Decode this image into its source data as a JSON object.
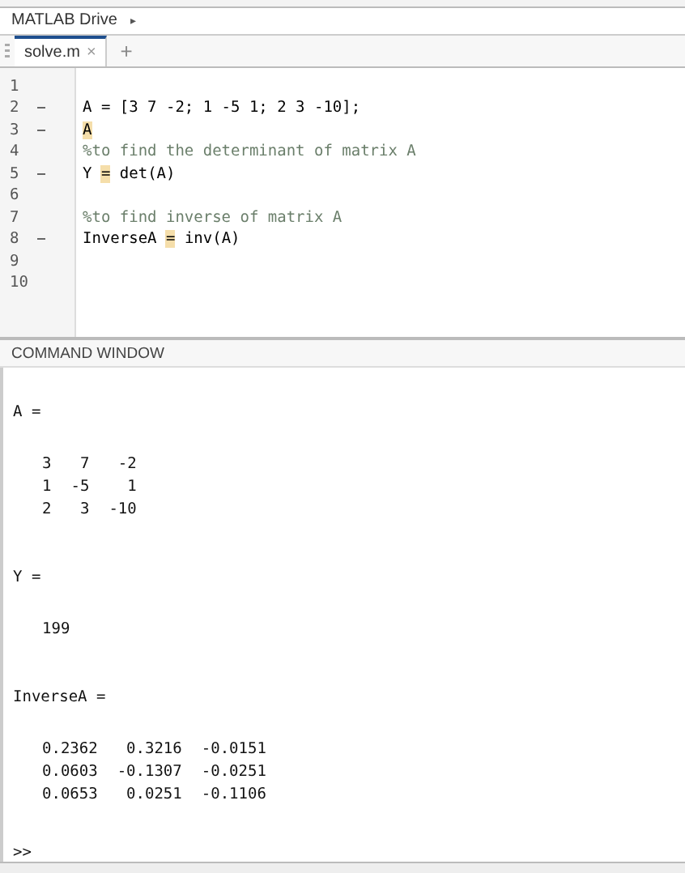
{
  "breadcrumb": {
    "label": "MATLAB Drive",
    "separator": "▸"
  },
  "tabs": [
    {
      "label": "solve.m",
      "selected": true,
      "close": "×"
    }
  ],
  "new_tab": "+",
  "editor": {
    "lines": [
      {
        "number": "1",
        "executable": false
      },
      {
        "number": "2",
        "executable": true,
        "kind": "code",
        "segments": [
          {
            "text": "A = [3 7 -2; 1 -5 1; 2 3 -10];",
            "highlight": false
          }
        ]
      },
      {
        "number": "3",
        "executable": true,
        "kind": "code",
        "segments": [
          {
            "text": "A",
            "highlight": true
          }
        ]
      },
      {
        "number": "4",
        "executable": false,
        "kind": "comment",
        "segments": [
          {
            "text": "%to find the determinant of matrix A",
            "highlight": false
          }
        ]
      },
      {
        "number": "5",
        "executable": true,
        "kind": "code",
        "segments": [
          {
            "text": "Y ",
            "highlight": false
          },
          {
            "text": "=",
            "highlight": true
          },
          {
            "text": " det(A)",
            "highlight": false
          }
        ]
      },
      {
        "number": "6",
        "executable": false
      },
      {
        "number": "7",
        "executable": false,
        "kind": "comment",
        "segments": [
          {
            "text": "%to find inverse of matrix A",
            "highlight": false
          }
        ]
      },
      {
        "number": "8",
        "executable": true,
        "kind": "code",
        "segments": [
          {
            "text": "InverseA ",
            "highlight": false
          },
          {
            "text": "=",
            "highlight": true
          },
          {
            "text": " inv(A)",
            "highlight": false
          }
        ]
      },
      {
        "number": "9",
        "executable": false
      },
      {
        "number": "10",
        "executable": false
      }
    ]
  },
  "command_window": {
    "title": "COMMAND WINDOW",
    "outputs": [
      {
        "variable": "A =",
        "rows": [
          [
            "3",
            "7",
            "-2"
          ],
          [
            "1",
            "-5",
            "1"
          ],
          [
            "2",
            "3",
            "-10"
          ]
        ]
      },
      {
        "variable": "Y =",
        "rows": [
          [
            "199"
          ]
        ]
      },
      {
        "variable": "InverseA =",
        "rows": [
          [
            "0.2362",
            "0.3216",
            "-0.0151"
          ],
          [
            "0.0603",
            "-0.1307",
            "-0.0251"
          ],
          [
            "0.0653",
            "0.0251",
            "-0.1106"
          ]
        ]
      }
    ],
    "prompt": ">>"
  }
}
